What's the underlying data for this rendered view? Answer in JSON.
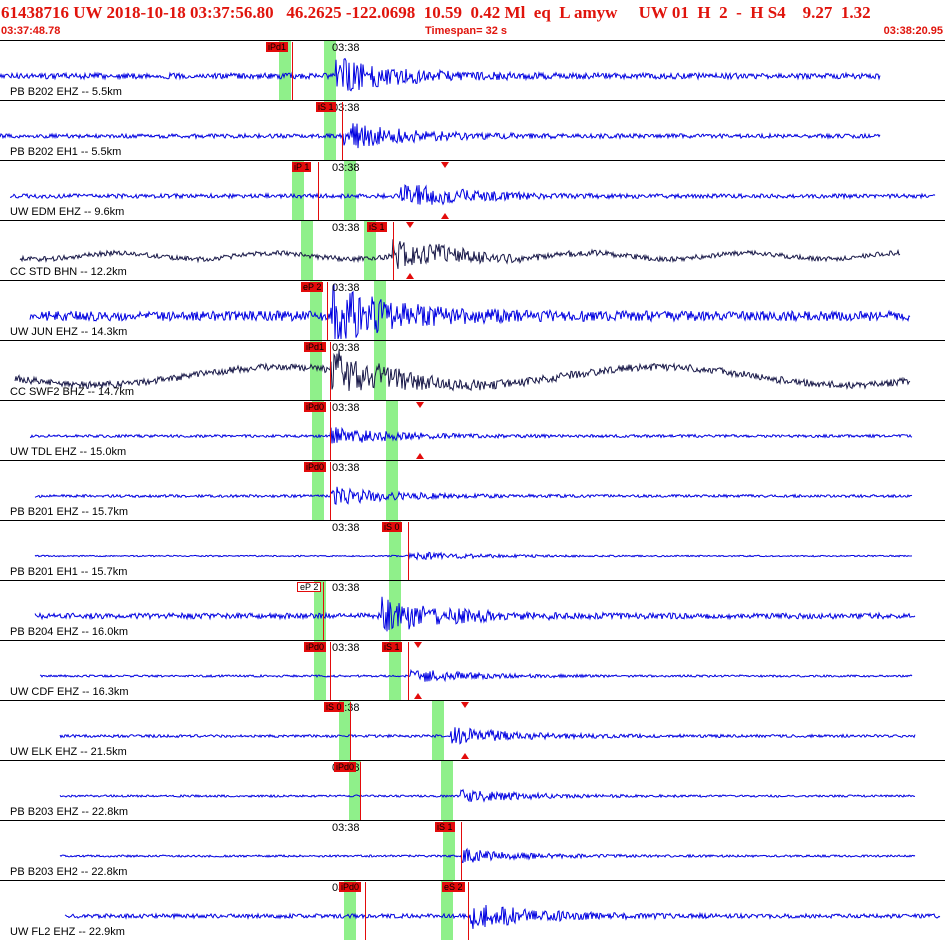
{
  "header": {
    "title": "61438716 UW 2018-10-18 03:37:56.80   46.2625 -122.0698  10.59  0.42 Ml  eq  L amyw     UW 01  H  2  -  H S4    9.27  1.32",
    "start_time": "03:37:48.78",
    "timespan": "Timespan=  32 s",
    "end_time": "03:38:20.95"
  },
  "colors": {
    "trace_blue": "#0000e0",
    "trace_dark": "#181848",
    "pick_red": "#e30b0b",
    "window_green": "#8ff08a",
    "header_red": "#e0140c"
  },
  "panels": [
    {
      "station": "PB B202 EHZ -- 5.5km",
      "time_label": "03:38",
      "trace_color": "#0000e0",
      "amp": 8,
      "picks": [
        {
          "label": "iPd1",
          "type": "P"
        }
      ]
    },
    {
      "station": "PB B202 EH1 -- 5.5km",
      "time_label": "03:38",
      "trace_color": "#0000e0",
      "amp": 6,
      "picks": [
        {
          "label": "iS 1",
          "type": "S"
        }
      ]
    },
    {
      "station": "UW EDM EHZ -- 9.6km",
      "time_label": "03:38",
      "trace_color": "#0000e0",
      "amp": 6,
      "picks": [
        {
          "label": "iP 1",
          "type": "P"
        }
      ]
    },
    {
      "station": "CC STD BHN -- 12.2km",
      "time_label": "03:38",
      "trace_color": "#181848",
      "amp": 7,
      "picks": [
        {
          "label": "iS 1",
          "type": "S"
        }
      ]
    },
    {
      "station": "UW JUN EHZ -- 14.3km",
      "time_label": "03:38",
      "trace_color": "#0000e0",
      "amp": 14,
      "picks": [
        {
          "label": "eP 2",
          "type": "P"
        }
      ]
    },
    {
      "station": "CC SWF2 BHZ -- 14.7km",
      "time_label": "03:38",
      "trace_color": "#181848",
      "amp": 10,
      "picks": [
        {
          "label": "iPd1",
          "type": "P"
        }
      ]
    },
    {
      "station": "UW TDL EHZ -- 15.0km",
      "time_label": "03:38",
      "trace_color": "#0000e0",
      "amp": 4,
      "picks": [
        {
          "label": "iPd0",
          "type": "P"
        }
      ]
    },
    {
      "station": "PB B201 EHZ -- 15.7km",
      "time_label": "03:38",
      "trace_color": "#0000e0",
      "amp": 4,
      "picks": [
        {
          "label": "iPd0",
          "type": "P"
        }
      ]
    },
    {
      "station": "PB B201 EH1 -- 15.7km",
      "time_label": "03:38",
      "trace_color": "#0000e0",
      "amp": 2,
      "picks": [
        {
          "label": "iS 0",
          "type": "S"
        }
      ]
    },
    {
      "station": "PB B204 EHZ -- 16.0km",
      "time_label": "03:38",
      "trace_color": "#0000e0",
      "amp": 8,
      "picks": [
        {
          "label": "eP 2",
          "type": "P",
          "hollow": true
        }
      ]
    },
    {
      "station": "UW CDF EHZ -- 16.3km",
      "time_label": "03:38",
      "trace_color": "#0000e0",
      "amp": 3,
      "picks": [
        {
          "label": "iPd0",
          "type": "P"
        },
        {
          "label": "iS 1",
          "type": "S"
        }
      ]
    },
    {
      "station": "UW ELK EHZ -- 21.5km",
      "time_label": "03:38",
      "trace_color": "#0000e0",
      "amp": 4,
      "picks": [
        {
          "label": "iS 0",
          "type": "P"
        }
      ]
    },
    {
      "station": "PB B203 EHZ -- 22.8km",
      "time_label": "03:38",
      "trace_color": "#0000e0",
      "amp": 3,
      "picks": [
        {
          "label": "iPd0",
          "type": "P"
        }
      ]
    },
    {
      "station": "PB B203 EH2 -- 22.8km",
      "time_label": "03:38",
      "trace_color": "#0000e0",
      "amp": 3,
      "picks": [
        {
          "label": "iS 1",
          "type": "S"
        }
      ]
    },
    {
      "station": "UW FL2 EHZ -- 22.9km",
      "time_label": "03:38",
      "trace_color": "#0000e0",
      "amp": 6,
      "picks": [
        {
          "label": "iPd0",
          "type": "P"
        },
        {
          "label": "eS 2",
          "type": "S"
        }
      ]
    }
  ]
}
